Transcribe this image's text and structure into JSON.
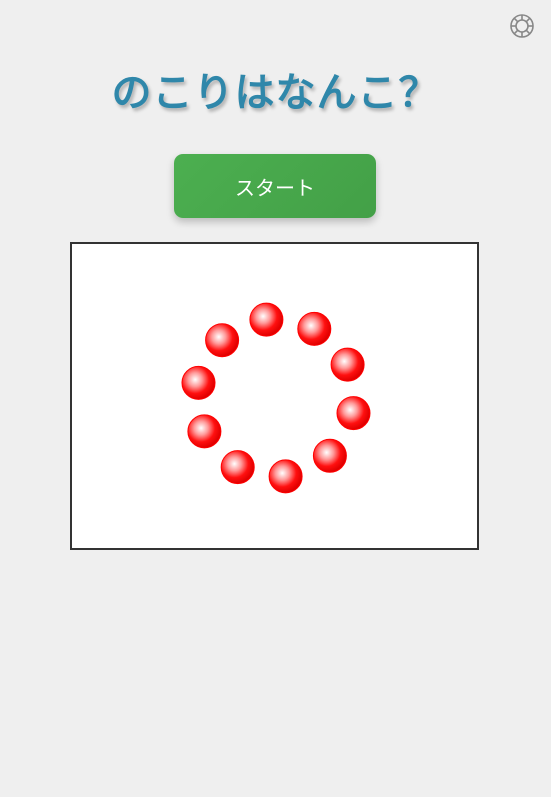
{
  "title": "のこりはなんこ？",
  "start_button": {
    "label": "スタート"
  },
  "settings": {
    "icon": "gear-icon"
  },
  "board": {
    "ball_count": 10,
    "ball_color": "#ff0000"
  },
  "colors": {
    "title": "#2f87aa",
    "button": "#4caf50",
    "background": "#efefef"
  }
}
